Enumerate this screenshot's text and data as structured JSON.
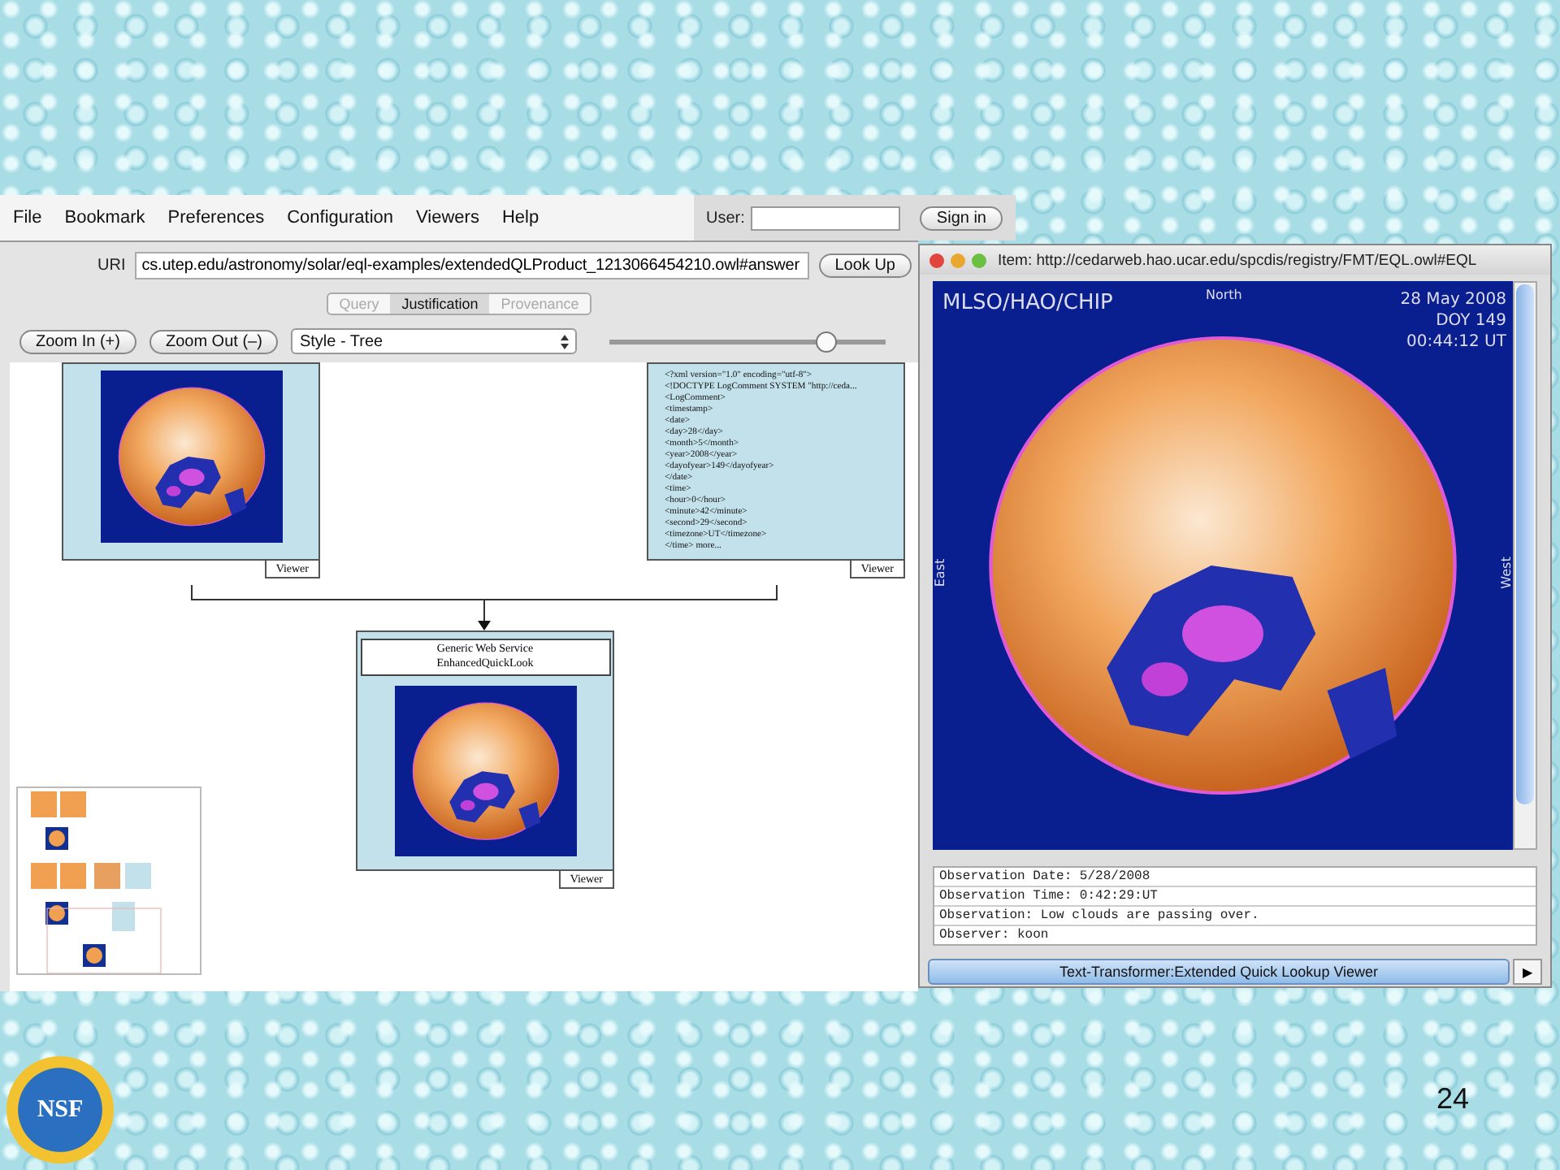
{
  "menu": [
    "File",
    "Bookmark",
    "Preferences",
    "Configuration",
    "Viewers",
    "Help"
  ],
  "user": {
    "label": "User:",
    "button": "Sign in"
  },
  "uri": {
    "label": "URI",
    "value": "cs.utep.edu/astronomy/solar/eql-examples/extendedQLProduct_1213066454210.owl#answer",
    "button": "Look Up"
  },
  "tabs": [
    {
      "label": "Query",
      "selected": false
    },
    {
      "label": "Justification",
      "selected": true
    },
    {
      "label": "Provenance",
      "selected": false
    }
  ],
  "toolbar": {
    "zoom_in": "Zoom In (+)",
    "zoom_out": "Zoom Out (–)",
    "style": "Style - Tree",
    "zoom_level": {
      "level": 0.78
    }
  },
  "graph": {
    "nodes": [
      {
        "kind": "image",
        "tab": "Viewer"
      },
      {
        "kind": "text",
        "tab": "Viewer",
        "lines": [
          "<?xml version=\"1.0\" encoding=\"utf-8\">",
          "<!DOCTYPE LogComment SYSTEM \"http://ceda...",
          "<LogComment>",
          "<timestamp>",
          "<date>",
          "<day>28</day>",
          "<month>5</month>",
          "<year>2008</year>",
          "<dayofyear>149</dayofyear>",
          "</date>",
          "<time>",
          "<hour>0</hour>",
          "<minute>42</minute>",
          "<second>29</second>",
          "<timezone>UT</timezone>",
          "</time> more..."
        ]
      },
      {
        "kind": "image",
        "tab": "Viewer",
        "title_lines": [
          "Generic Web Service",
          "EnhancedQuickLook"
        ]
      }
    ]
  },
  "viewer": {
    "title": "Item: http://cedarweb.hao.ucar.edu/spcdis/registry/FMT/EQL.owl#EQL",
    "image_labels": {
      "source": "MLSO/HAO/CHIP",
      "north": "North",
      "date": "28 May 2008",
      "doy": "DOY 149",
      "time": "00:44:12 UT",
      "east": "East",
      "west": "West"
    },
    "fields": [
      "Observation Date: 5/28/2008",
      "Observation Time: 0:42:29:UT",
      "Observation: Low clouds are passing over.",
      "Observer: koon"
    ],
    "footer": "Text-Transformer:Extended Quick Lookup Viewer",
    "footer_arrow": "▶"
  },
  "slide": {
    "logo_text": "NSF",
    "number": "24"
  }
}
